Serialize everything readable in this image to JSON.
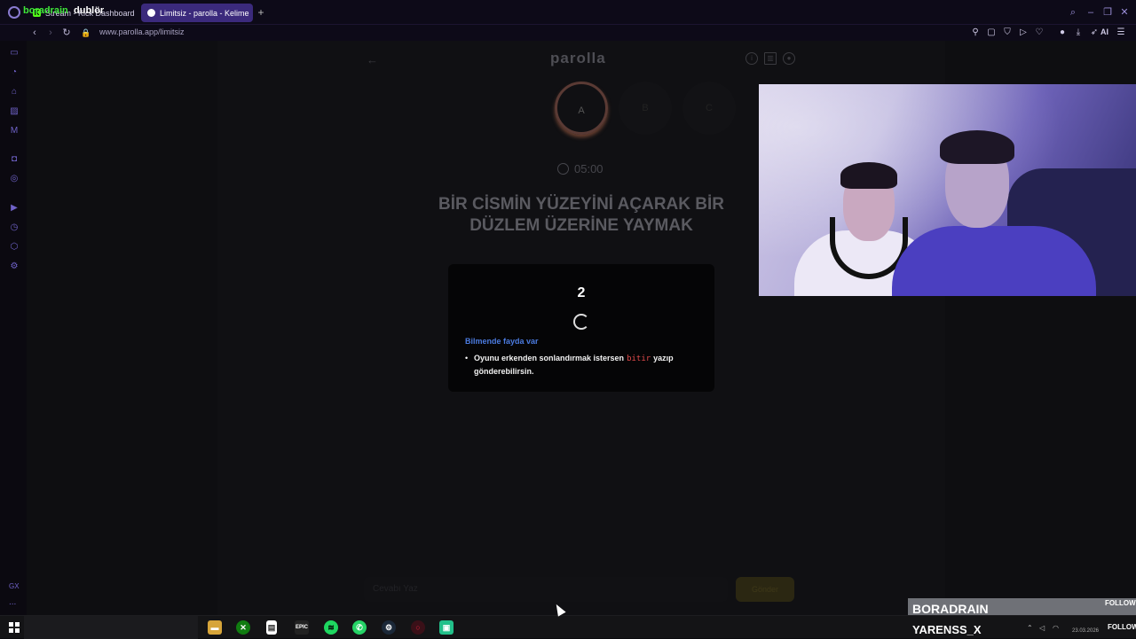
{
  "browser": {
    "tabs": [
      {
        "label": "Stream - Kick Dashboard",
        "favicon": "K",
        "active": false
      },
      {
        "label": "Limitsiz - parolla - Kelime",
        "active": true
      }
    ],
    "url": "www.parolla.app/limitsiz",
    "toolbar_ai_label": "AI"
  },
  "sidebar": {
    "gx_label": "GX",
    "more_label": "..."
  },
  "game": {
    "logo": "parolla",
    "letters": [
      "A",
      "B",
      "C"
    ],
    "timer": "05:00",
    "question": "BİR CİSMİN YÜZEYİNİ AÇARAK BİR DÜZLEM ÜZERİNE YAYMAK",
    "modal": {
      "countdown": "2",
      "tip_heading": "Bilmende fayda var",
      "tip_before": "Oyunu erkenden sonlandırmak istersen",
      "tip_code": "bitir",
      "tip_after": "yazıp gönderebilirsin."
    },
    "input_placeholder": "Cevabı Yaz",
    "send_label": "Gönder"
  },
  "overlay": {
    "follower_1": "BORADRAIN",
    "follow_label_1": "FOLLOW",
    "follower_2": "YARENSS_X",
    "follow_label_2": "FOLLOW"
  },
  "taskbar": {
    "search_text_1": "boradrain",
    "search_text_2": "dublör",
    "date": "23.03.2026",
    "apps": [
      "file-explorer",
      "xbox",
      "notepad",
      "epic-games",
      "spotify",
      "whatsapp",
      "steam",
      "opera-gx",
      "kick"
    ]
  },
  "colors": {
    "accent": "#3b2a7c",
    "kick_green": "#53fc18",
    "tip_blue": "#4b7be0",
    "code_red": "#e24b4b"
  }
}
